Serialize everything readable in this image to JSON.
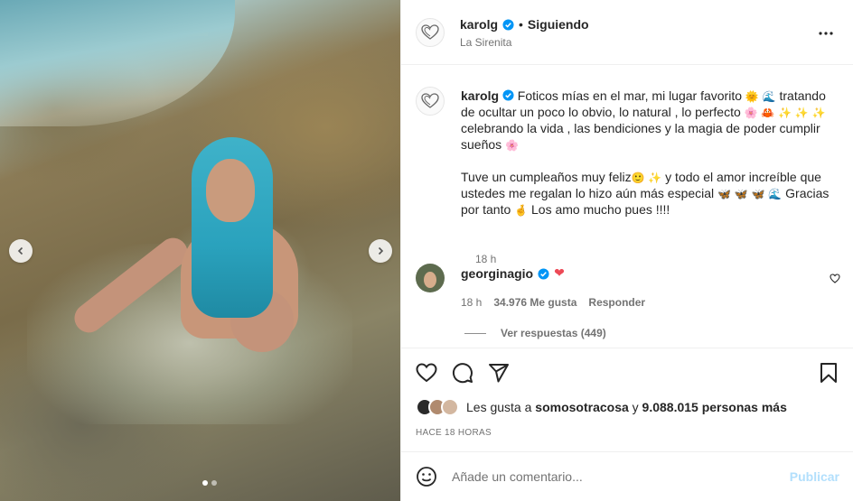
{
  "post": {
    "username": "karolg",
    "follow_separator": "•",
    "follow_status": "Siguiendo",
    "location": "La Sirenita"
  },
  "caption": {
    "username": "karolg",
    "line1_text": "Foticos mías en el mar, mi lugar favorito",
    "line1_emojis": "🌞 🌊",
    "line2_text": "tratando de ocultar un poco lo obvio, lo natural , lo perfecto",
    "line2_emojis": "🌸 🦀 ✨ ✨ ✨",
    "line3_text": "celebrando la vida , las bendiciones y la magia de poder cumplir sueños",
    "line3_emojis": "🌸",
    "para2_a": "Tuve un cumpleaños muy feliz",
    "para2_emojis_a": "🙂 ✨",
    "para2_b": "y todo el amor increíble que ustedes me regalan lo hizo aún más especial",
    "para2_emojis_b": "🦋 🦋 🦋 🌊",
    "para2_c": "Gracias por tanto",
    "para2_emojis_c": "🤞",
    "para2_d": "Los amo mucho pues !!!!",
    "time": "18 h"
  },
  "comment": {
    "username": "georginagio",
    "heart_emoji": "❤",
    "time": "18 h",
    "likes": "34.976 Me gusta",
    "reply": "Responder",
    "view_replies": "Ver respuestas (449)"
  },
  "likes": {
    "prefix": "Les gusta a",
    "user": "somosotracosa",
    "connector": "y",
    "others": "9.088.015 personas más"
  },
  "post_time": "HACE 18 HORAS",
  "add_comment": {
    "placeholder": "Añade un comentario...",
    "publish": "Publicar"
  },
  "icons": {
    "more": "more-options-icon",
    "like": "heart-icon",
    "comment": "comment-icon",
    "share": "share-icon",
    "save": "bookmark-icon",
    "emoji": "emoji-icon",
    "prev": "chevron-left-icon",
    "next": "chevron-right-icon"
  },
  "colors": {
    "verified": "#0095f6",
    "heart": "#ed4956",
    "publish_disabled": "#b2dffc",
    "muted_text": "#737373"
  }
}
